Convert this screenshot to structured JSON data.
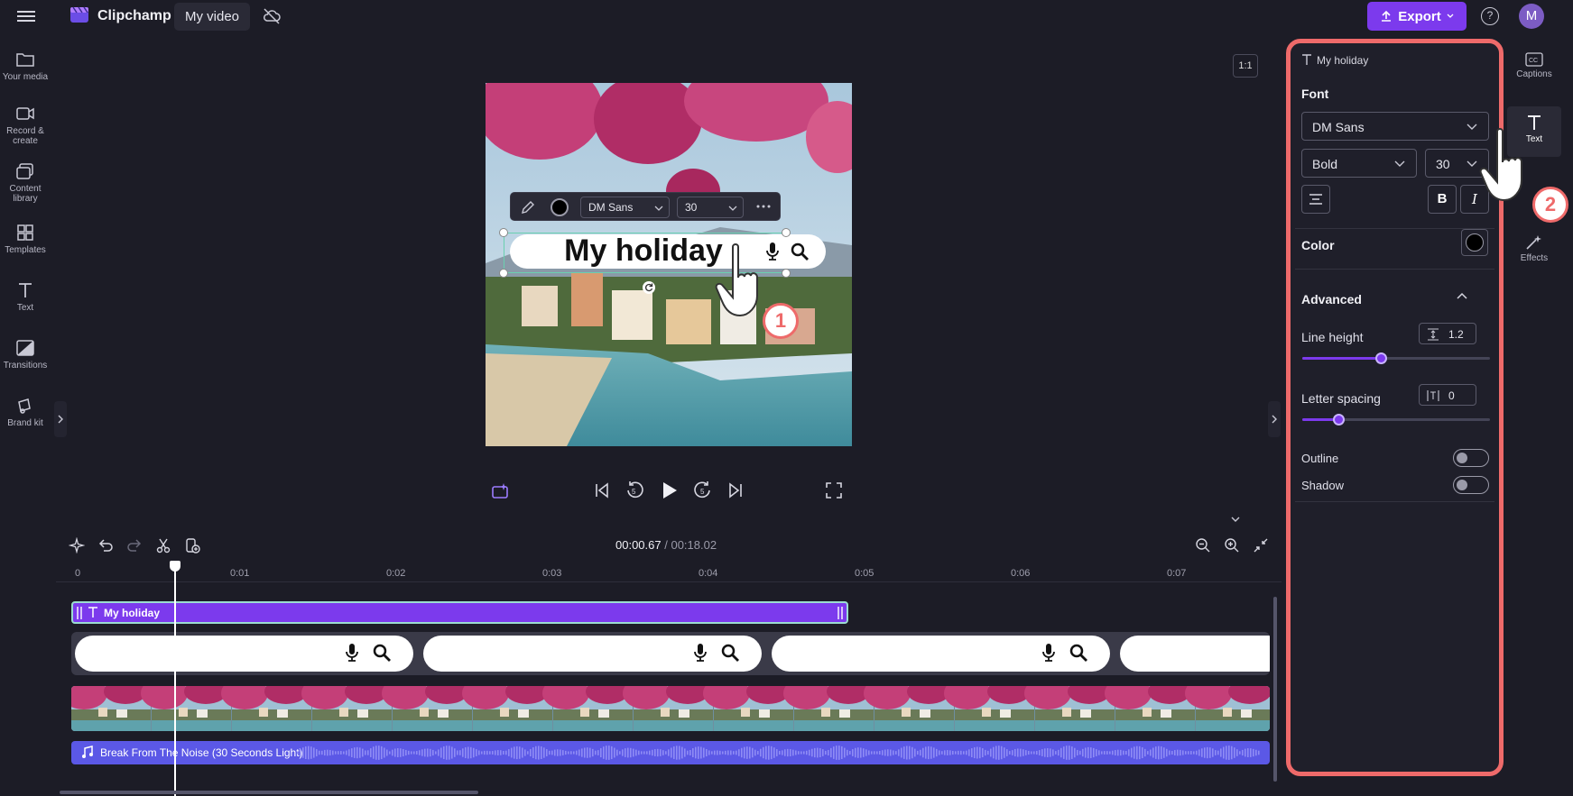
{
  "app": {
    "name": "Clipchamp",
    "project_title": "My video",
    "export_label": "Export",
    "help_label": "?",
    "avatar_initial": "M"
  },
  "left_nav": [
    {
      "label_line1": "Your media",
      "label_line2": ""
    },
    {
      "label_line1": "Record &",
      "label_line2": "create"
    },
    {
      "label_line1": "Content",
      "label_line2": "library"
    },
    {
      "label_line1": "Templates",
      "label_line2": ""
    },
    {
      "label_line1": "Text",
      "label_line2": ""
    },
    {
      "label_line1": "Transitions",
      "label_line2": ""
    },
    {
      "label_line1": "Brand kit",
      "label_line2": ""
    }
  ],
  "stage": {
    "aspect_ratio": "1:1",
    "text_overlay": "My holiday",
    "toolbar": {
      "font": "DM Sans",
      "size": "30"
    }
  },
  "timeline": {
    "current_time": "00:00.67",
    "total_time": "/ 00:18.02",
    "ruler_ticks": [
      "0",
      "0:01",
      "0:02",
      "0:03",
      "0:04",
      "0:05",
      "0:06",
      "0:07"
    ],
    "text_clip_label": "My holiday",
    "audio_clip_label": "Break From The Noise (30 Seconds Light)"
  },
  "panel": {
    "header": "My holiday",
    "font_section": "Font",
    "font_family": "DM Sans",
    "font_weight": "Bold",
    "font_size": "30",
    "bold_label": "B",
    "italic_label": "I",
    "color_section": "Color",
    "color_value": "#000000",
    "advanced_section": "Advanced",
    "line_height_label": "Line height",
    "line_height_value": "1.2",
    "line_height_fraction": 0.42,
    "letter_spacing_label": "Letter spacing",
    "letter_spacing_value": "0",
    "letter_spacing_fraction": 0.19,
    "outline_label": "Outline",
    "outline_on": false,
    "shadow_label": "Shadow",
    "shadow_on": false
  },
  "right_sidebar": [
    {
      "label": "Captions"
    },
    {
      "label": "Text"
    },
    {
      "label": "Effects"
    }
  ],
  "callouts": [
    "1",
    "2"
  ],
  "colors": {
    "accent": "#7c3aed",
    "highlight_border": "#ee6a6a",
    "audio_track": "#5b58e6"
  }
}
